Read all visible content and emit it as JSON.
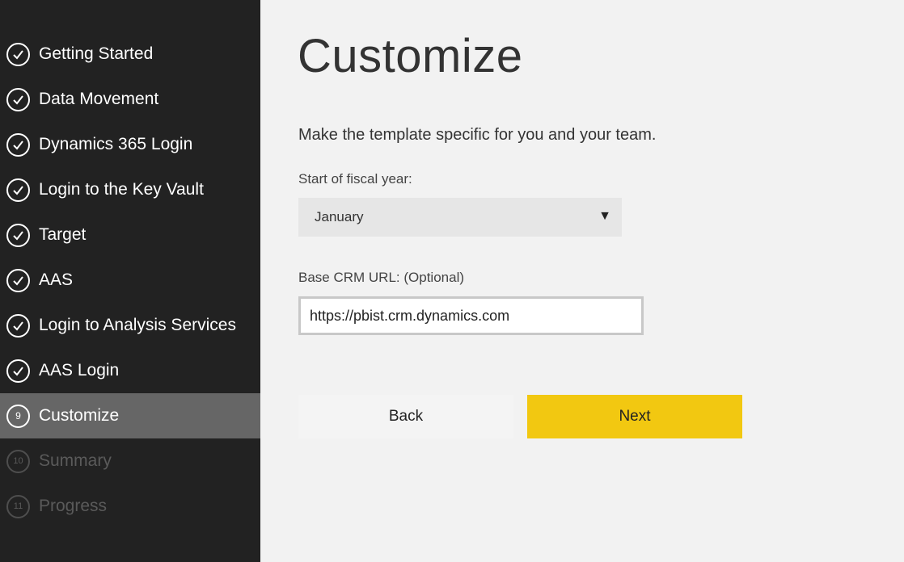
{
  "sidebar": {
    "steps": [
      {
        "label": "Getting Started",
        "state": "done"
      },
      {
        "label": "Data Movement",
        "state": "done"
      },
      {
        "label": "Dynamics 365 Login",
        "state": "done"
      },
      {
        "label": "Login to the Key Vault",
        "state": "done"
      },
      {
        "label": "Target",
        "state": "done"
      },
      {
        "label": "AAS",
        "state": "done"
      },
      {
        "label": "Login to Analysis Services",
        "state": "done"
      },
      {
        "label": "AAS Login",
        "state": "done"
      },
      {
        "label": "Customize",
        "state": "active",
        "number": "9"
      },
      {
        "label": "Summary",
        "state": "pending",
        "number": "10"
      },
      {
        "label": "Progress",
        "state": "pending",
        "number": "11"
      }
    ]
  },
  "main": {
    "title": "Customize",
    "subtitle": "Make the template specific for you and your team.",
    "fiscal_year": {
      "label": "Start of fiscal year:",
      "selected": "January",
      "arrow_icon": "triangle-down-icon"
    },
    "crm_url": {
      "label": "Base CRM URL: (Optional)",
      "value": "https://pbist.crm.dynamics.com"
    },
    "buttons": {
      "back_label": "Back",
      "next_label": "Next"
    }
  },
  "colors": {
    "sidebar_bg": "#222222",
    "active_step_bg": "#666666",
    "accent": "#f2c811",
    "page_bg": "#f2f2f2"
  }
}
